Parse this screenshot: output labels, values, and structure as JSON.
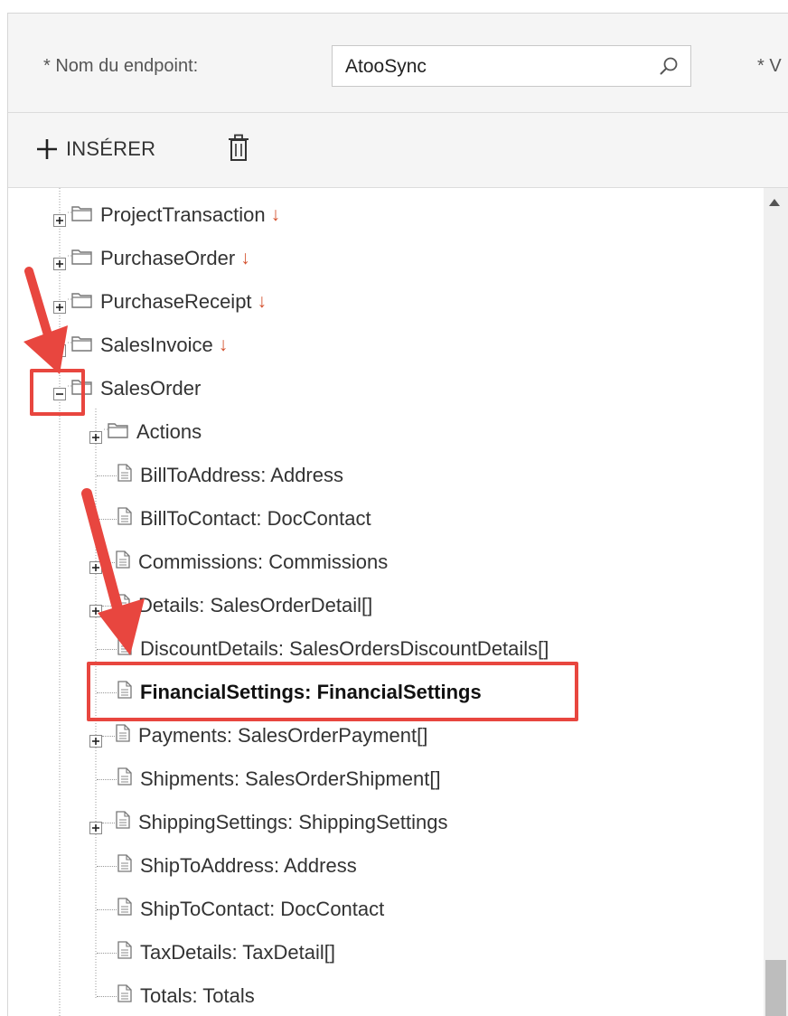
{
  "endpoint": {
    "name_label": "* Nom du endpoint:",
    "name_value": "AtooSync",
    "next_label": "* V"
  },
  "toolbar": {
    "insert_label": "INSÉRER"
  },
  "tree": {
    "items": [
      {
        "label": "ProjectTransaction",
        "sort": "↓"
      },
      {
        "label": "PurchaseOrder",
        "sort": "↓"
      },
      {
        "label": "PurchaseReceipt",
        "sort": "↓"
      },
      {
        "label": "SalesInvoice",
        "sort": "↓"
      },
      {
        "label": "SalesOrder",
        "sort": ""
      },
      {
        "label": "Actions"
      },
      {
        "label": "BillToAddress: Address"
      },
      {
        "label": "BillToContact: DocContact"
      },
      {
        "label": "Commissions: Commissions"
      },
      {
        "label": "Details: SalesOrderDetail[]"
      },
      {
        "label": "DiscountDetails: SalesOrdersDiscountDetails[]"
      },
      {
        "label": "FinancialSettings: FinancialSettings"
      },
      {
        "label": "Payments: SalesOrderPayment[]"
      },
      {
        "label": "Shipments: SalesOrderShipment[]"
      },
      {
        "label": "ShippingSettings: ShippingSettings"
      },
      {
        "label": "ShipToAddress: Address"
      },
      {
        "label": "ShipToContact: DocContact"
      },
      {
        "label": "TaxDetails: TaxDetail[]"
      },
      {
        "label": "Totals: Totals"
      }
    ]
  },
  "colors": {
    "annotation_red": "#e8463f",
    "sort_arrow": "#d4522f"
  }
}
